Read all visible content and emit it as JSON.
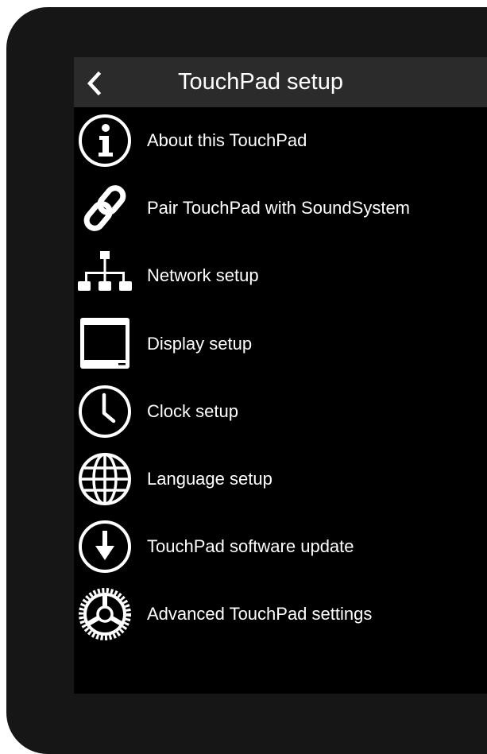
{
  "header": {
    "title": "TouchPad setup",
    "back_icon": "chevron-left-icon"
  },
  "menu": {
    "items": [
      {
        "label": "About this TouchPad",
        "icon": "info-icon"
      },
      {
        "label": "Pair TouchPad with SoundSystem",
        "icon": "link-icon"
      },
      {
        "label": "Network setup",
        "icon": "network-icon"
      },
      {
        "label": "Display setup",
        "icon": "display-icon"
      },
      {
        "label": "Clock setup",
        "icon": "clock-icon"
      },
      {
        "label": "Language setup",
        "icon": "globe-icon"
      },
      {
        "label": "TouchPad software update",
        "icon": "download-icon"
      },
      {
        "label": "Advanced TouchPad settings",
        "icon": "gear-icon"
      }
    ]
  },
  "colors": {
    "bezel": "#161616",
    "screen": "#000000",
    "header_bar": "#2b2b2b",
    "text": "#ffffff"
  }
}
